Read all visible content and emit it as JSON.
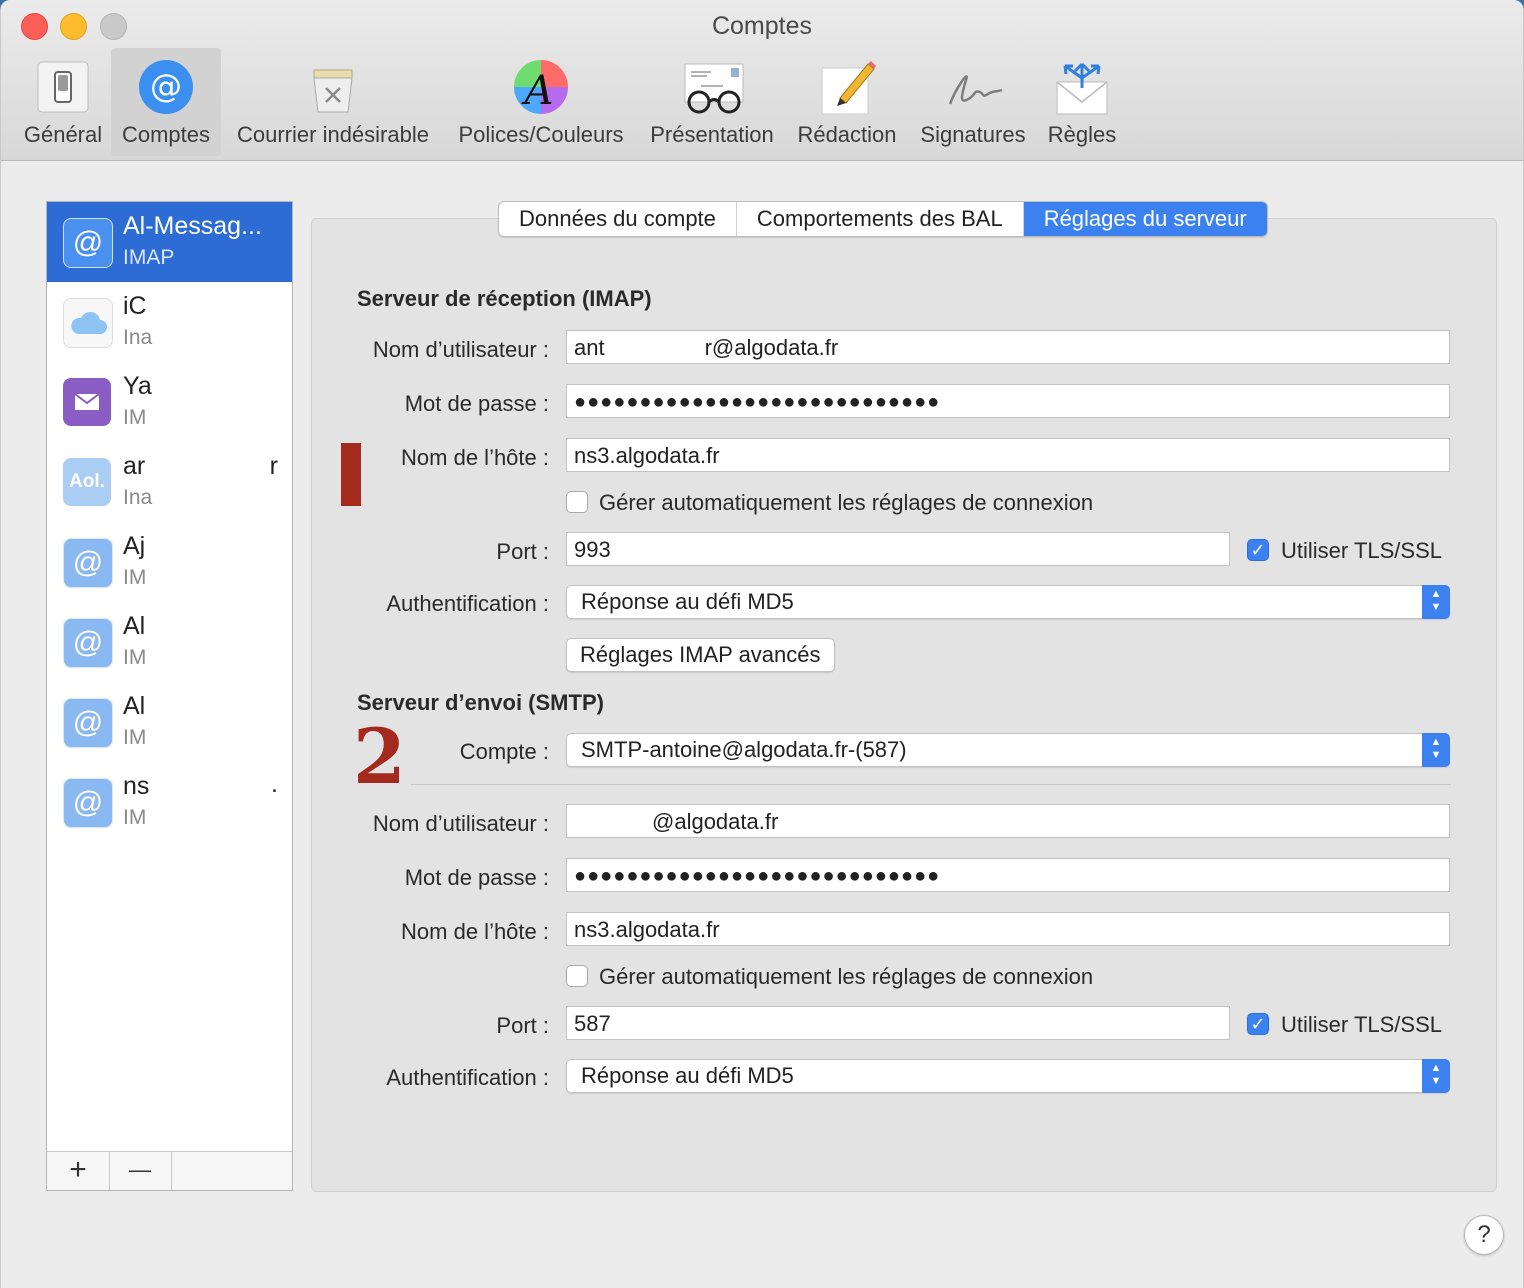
{
  "window": {
    "title": "Comptes"
  },
  "toolbar": {
    "items": [
      {
        "label": "Général",
        "icon": "general-switch-icon"
      },
      {
        "label": "Comptes",
        "icon": "at-sign-icon",
        "active": true
      },
      {
        "label": "Courrier indésirable",
        "icon": "junk-bin-icon"
      },
      {
        "label": "Polices/Couleurs",
        "icon": "fonts-colors-icon"
      },
      {
        "label": "Présentation",
        "icon": "glasses-letter-icon"
      },
      {
        "label": "Rédaction",
        "icon": "pencil-note-icon"
      },
      {
        "label": "Signatures",
        "icon": "signature-icon"
      },
      {
        "label": "Règles",
        "icon": "rules-envelope-icon"
      }
    ]
  },
  "sidebar": {
    "accounts": [
      {
        "name": "Al-Messag...",
        "type": "IMAP",
        "icon": "at-sign-icon",
        "selected": true
      },
      {
        "name": "iC",
        "type": "Ina",
        "icon": "icloud-icon"
      },
      {
        "name": "Ya",
        "type": "IM",
        "icon": "yahoo-envelope-icon"
      },
      {
        "name": "ar",
        "type": "Ina",
        "icon": "aol-icon",
        "trail": "r"
      },
      {
        "name": "Aj",
        "type": "IM",
        "icon": "at-sign-icon"
      },
      {
        "name": "Al",
        "type": "IM",
        "icon": "at-sign-icon"
      },
      {
        "name": "Al",
        "type": "IM",
        "icon": "at-sign-icon"
      },
      {
        "name": "ns",
        "type": "IM",
        "icon": "at-sign-icon",
        "trail": "."
      }
    ],
    "add_label": "+",
    "remove_label": "—"
  },
  "tabs": [
    {
      "label": "Données du compte"
    },
    {
      "label": "Comportements des BAL"
    },
    {
      "label": "Réglages du serveur",
      "active": true
    }
  ],
  "incoming": {
    "title": "Serveur de réception (IMAP)",
    "username_label": "Nom d’utilisateur :",
    "username_start": "ant",
    "username_end": "r@algodata.fr",
    "password_label": "Mot de passe :",
    "password": "●●●●●●●●●●●●●●●●●●●●●●●●●●●●",
    "host_label": "Nom de l’hôte :",
    "host": "ns3.algodata.fr",
    "auto_label": "Gérer automatiquement les réglages de connexion",
    "auto_checked": false,
    "port_label": "Port :",
    "port": "993",
    "tls_label": "Utiliser TLS/SSL",
    "tls_checked": true,
    "auth_label": "Authentification :",
    "auth_value": "Réponse au défi MD5",
    "advanced_button": "Réglages IMAP avancés",
    "marker": "1"
  },
  "outgoing": {
    "title": "Serveur d’envoi (SMTP)",
    "account_label": "Compte :",
    "account_value": "SMTP-antoine@algodata.fr-(587)",
    "username_label": "Nom d’utilisateur :",
    "username_end": "@algodata.fr",
    "password_label": "Mot de passe :",
    "password": "●●●●●●●●●●●●●●●●●●●●●●●●●●●●",
    "host_label": "Nom de l’hôte :",
    "host": "ns3.algodata.fr",
    "auto_label": "Gérer automatiquement les réglages de connexion",
    "auto_checked": false,
    "port_label": "Port :",
    "port": "587",
    "tls_label": "Utiliser TLS/SSL",
    "tls_checked": true,
    "auth_label": "Authentification :",
    "auth_value": "Réponse au défi MD5",
    "marker": "2"
  },
  "help_label": "?",
  "colors": {
    "accent": "#3b82f0",
    "selection": "#2d6bd5",
    "marker": "#a32a1d"
  }
}
